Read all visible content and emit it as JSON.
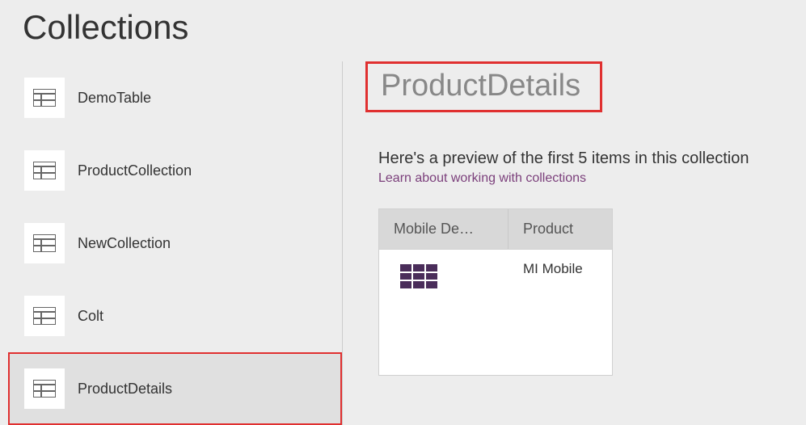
{
  "page_title": "Collections",
  "sidebar": {
    "items": [
      {
        "label": "DemoTable",
        "slug": "demotable"
      },
      {
        "label": "ProductCollection",
        "slug": "productcollection"
      },
      {
        "label": "NewCollection",
        "slug": "newcollection"
      },
      {
        "label": "Colt",
        "slug": "colt"
      },
      {
        "label": "ProductDetails",
        "slug": "productdetails"
      }
    ],
    "selected_index": 4
  },
  "main": {
    "collection_title": "ProductDetails",
    "preview_text": "Here's a preview of the first 5 items in this collection",
    "learn_link": "Learn about working with collections",
    "table": {
      "columns": [
        "Mobile De…",
        "Product"
      ],
      "rows": [
        {
          "mobile_details_is_table": true,
          "product": "MI Mobile"
        }
      ]
    }
  }
}
